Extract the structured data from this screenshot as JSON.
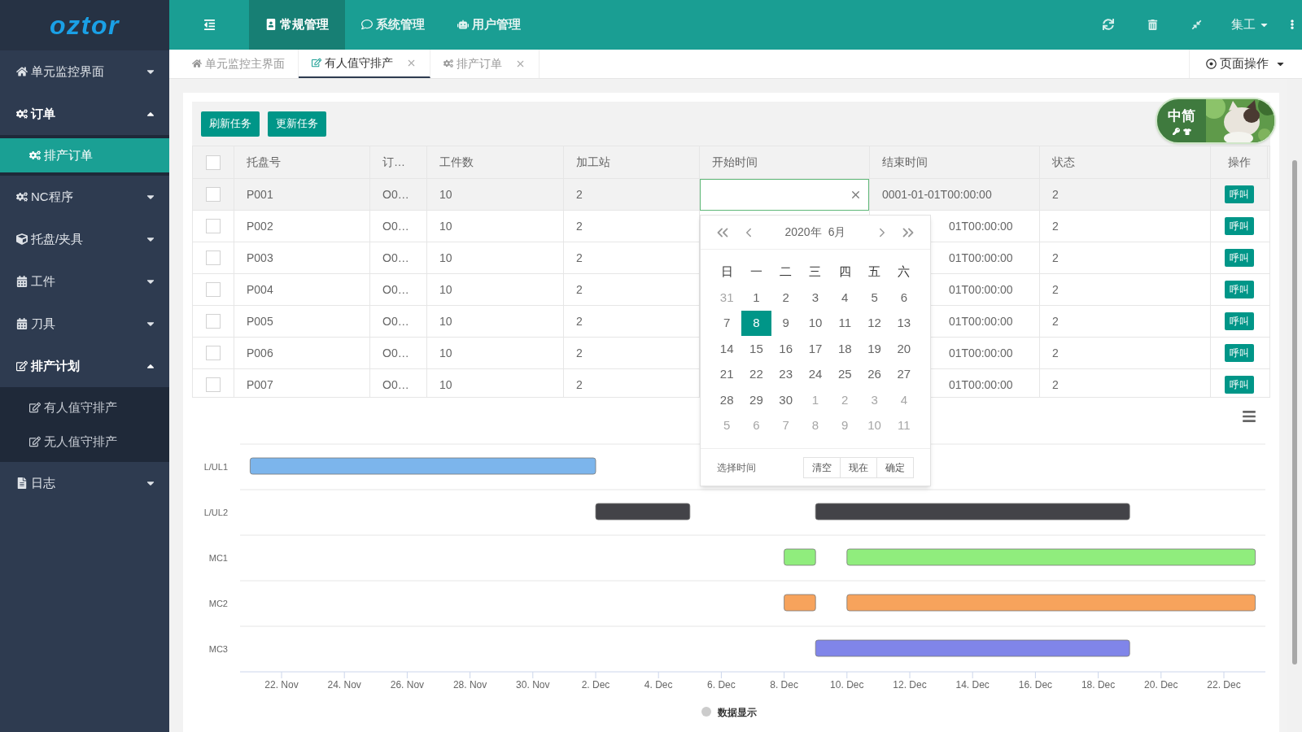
{
  "logo": "oztor",
  "topbar": {
    "tabs": [
      {
        "label": "常规管理",
        "selected": true
      },
      {
        "label": "系统管理",
        "selected": false
      },
      {
        "label": "用户管理",
        "selected": false
      }
    ],
    "user": "集工"
  },
  "sidebar": {
    "items": [
      {
        "label": "单元监控界面",
        "expanded": false
      },
      {
        "label": "订单",
        "expanded": true,
        "children": [
          {
            "label": "排产订单",
            "selected": true
          }
        ]
      },
      {
        "label": "NC程序",
        "expanded": false
      },
      {
        "label": "托盘/夹具",
        "expanded": false
      },
      {
        "label": "工件",
        "expanded": false
      },
      {
        "label": "刀具",
        "expanded": false
      },
      {
        "label": "排产计划",
        "expanded": true,
        "children": [
          {
            "label": "有人值守排产",
            "selected": false
          },
          {
            "label": "无人值守排产",
            "selected": false
          }
        ]
      },
      {
        "label": "日志",
        "expanded": false
      }
    ]
  },
  "page_tabs": [
    {
      "label": "单元监控主界面",
      "selected": false,
      "closable": false
    },
    {
      "label": "有人值守排产",
      "selected": true,
      "closable": true
    },
    {
      "label": "排产订单",
      "selected": false,
      "closable": true
    }
  ],
  "page_actions": "页面操作",
  "widget": {
    "label": "中简"
  },
  "toolbar": {
    "buttons": [
      "刷新任务",
      "更新任务"
    ]
  },
  "table": {
    "all_checked": false,
    "columns": [
      "托盘号",
      "订…",
      "工件数",
      "加工站",
      "开始时间",
      "结束时间",
      "状态",
      "操作"
    ],
    "rows": [
      {
        "checked": false,
        "hover": true,
        "editing": true,
        "pallet": "P001",
        "order": "O0…",
        "parts": "10",
        "station": "2",
        "end": "0001-01-01T00:00:00",
        "covered": false,
        "status": "2",
        "action": "呼叫"
      },
      {
        "checked": false,
        "hover": false,
        "editing": false,
        "pallet": "P002",
        "order": "O0…",
        "parts": "10",
        "station": "2",
        "end": "01T00:00:00",
        "covered": true,
        "status": "2",
        "action": "呼叫"
      },
      {
        "checked": false,
        "hover": false,
        "editing": false,
        "pallet": "P003",
        "order": "O0…",
        "parts": "10",
        "station": "2",
        "end": "01T00:00:00",
        "covered": true,
        "status": "2",
        "action": "呼叫"
      },
      {
        "checked": false,
        "hover": false,
        "editing": false,
        "pallet": "P004",
        "order": "O0…",
        "parts": "10",
        "station": "2",
        "end": "01T00:00:00",
        "covered": true,
        "status": "2",
        "action": "呼叫"
      },
      {
        "checked": false,
        "hover": false,
        "editing": false,
        "pallet": "P005",
        "order": "O0…",
        "parts": "10",
        "station": "2",
        "end": "01T00:00:00",
        "covered": true,
        "status": "2",
        "action": "呼叫"
      },
      {
        "checked": false,
        "hover": false,
        "editing": false,
        "pallet": "P006",
        "order": "O0…",
        "parts": "10",
        "station": "2",
        "end": "01T00:00:00",
        "covered": true,
        "status": "2",
        "action": "呼叫"
      },
      {
        "checked": false,
        "hover": false,
        "editing": false,
        "pallet": "P007",
        "order": "O0…",
        "parts": "10",
        "station": "2",
        "end": "01T00:00:00",
        "covered": true,
        "status": "2",
        "action": "呼叫"
      }
    ]
  },
  "calendar": {
    "year": "2020年",
    "month": "6月",
    "weekdays": [
      "日",
      "一",
      "二",
      "三",
      "四",
      "五",
      "六"
    ],
    "days": [
      {
        "label": "31",
        "outside": true,
        "selected": false
      },
      {
        "label": "1",
        "outside": false,
        "selected": false
      },
      {
        "label": "2",
        "outside": false,
        "selected": false
      },
      {
        "label": "3",
        "outside": false,
        "selected": false
      },
      {
        "label": "4",
        "outside": false,
        "selected": false
      },
      {
        "label": "5",
        "outside": false,
        "selected": false
      },
      {
        "label": "6",
        "outside": false,
        "selected": false
      },
      {
        "label": "7",
        "outside": false,
        "selected": false
      },
      {
        "label": "8",
        "outside": false,
        "selected": true
      },
      {
        "label": "9",
        "outside": false,
        "selected": false
      },
      {
        "label": "10",
        "outside": false,
        "selected": false
      },
      {
        "label": "11",
        "outside": false,
        "selected": false
      },
      {
        "label": "12",
        "outside": false,
        "selected": false
      },
      {
        "label": "13",
        "outside": false,
        "selected": false
      },
      {
        "label": "14",
        "outside": false,
        "selected": false
      },
      {
        "label": "15",
        "outside": false,
        "selected": false
      },
      {
        "label": "16",
        "outside": false,
        "selected": false
      },
      {
        "label": "17",
        "outside": false,
        "selected": false
      },
      {
        "label": "18",
        "outside": false,
        "selected": false
      },
      {
        "label": "19",
        "outside": false,
        "selected": false
      },
      {
        "label": "20",
        "outside": false,
        "selected": false
      },
      {
        "label": "21",
        "outside": false,
        "selected": false
      },
      {
        "label": "22",
        "outside": false,
        "selected": false
      },
      {
        "label": "23",
        "outside": false,
        "selected": false
      },
      {
        "label": "24",
        "outside": false,
        "selected": false
      },
      {
        "label": "25",
        "outside": false,
        "selected": false
      },
      {
        "label": "26",
        "outside": false,
        "selected": false
      },
      {
        "label": "27",
        "outside": false,
        "selected": false
      },
      {
        "label": "28",
        "outside": false,
        "selected": false
      },
      {
        "label": "29",
        "outside": false,
        "selected": false
      },
      {
        "label": "30",
        "outside": false,
        "selected": false
      },
      {
        "label": "1",
        "outside": true,
        "selected": false
      },
      {
        "label": "2",
        "outside": true,
        "selected": false
      },
      {
        "label": "3",
        "outside": true,
        "selected": false
      },
      {
        "label": "4",
        "outside": true,
        "selected": false
      },
      {
        "label": "5",
        "outside": true,
        "selected": false
      },
      {
        "label": "6",
        "outside": true,
        "selected": false
      },
      {
        "label": "7",
        "outside": true,
        "selected": false
      },
      {
        "label": "8",
        "outside": true,
        "selected": false
      },
      {
        "label": "9",
        "outside": true,
        "selected": false
      },
      {
        "label": "10",
        "outside": true,
        "selected": false
      },
      {
        "label": "11",
        "outside": true,
        "selected": false
      }
    ],
    "footer_link": "选择时间",
    "buttons": [
      "清空",
      "现在",
      "确定"
    ]
  },
  "timeline": {
    "rows": [
      {
        "label": "L/UL1",
        "color": "#7cb5ec"
      },
      {
        "label": "L/UL2",
        "color": "#434348"
      },
      {
        "label": "MC1",
        "color": "#90ed7d"
      },
      {
        "label": "MC2",
        "color": "#f7a35c"
      },
      {
        "label": "MC3",
        "color": "#8085e9"
      }
    ],
    "ticks": [
      "22. Nov",
      "24. Nov",
      "26. Nov",
      "28. Nov",
      "30. Nov",
      "2. Dec",
      "4. Dec",
      "6. Dec",
      "8. Dec",
      "10. Dec",
      "12. Dec",
      "14. Dec",
      "16. Dec",
      "18. Dec",
      "20. Dec",
      "22. Dec"
    ],
    "legend": {
      "label": "数据显示",
      "color": "#cccccc"
    }
  }
}
